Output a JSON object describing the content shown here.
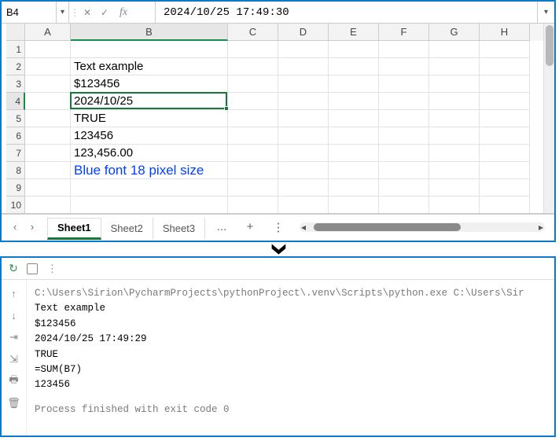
{
  "formula_bar": {
    "name_box": "B4",
    "fx_label": "fx",
    "formula_value": "2024/10/25  17:49:30"
  },
  "columns": [
    "A",
    "B",
    "C",
    "D",
    "E",
    "F",
    "G",
    "H"
  ],
  "rows": [
    "1",
    "2",
    "3",
    "4",
    "5",
    "6",
    "7",
    "8",
    "9",
    "10"
  ],
  "selected_cell": "B4",
  "cells": {
    "B2": "Text example",
    "B3": "$123456",
    "B4": "2024/10/25",
    "B5": "TRUE",
    "B6": "123456",
    "B7": "123,456.00",
    "B8": "Blue font 18 pixel size"
  },
  "sheet_tabs": {
    "tabs": [
      "Sheet1",
      "Sheet2",
      "Sheet3"
    ],
    "active": "Sheet1",
    "more": "...",
    "add": "+"
  },
  "terminal": {
    "path_line": "C:\\Users\\Sirion\\PycharmProjects\\pythonProject\\.venv\\Scripts\\python.exe C:\\Users\\Sir",
    "lines": [
      "Text example",
      "$123456",
      "2024/10/25 17:49:29",
      "TRUE",
      "=SUM(B7)",
      "123456"
    ],
    "exit_line": "Process finished with exit code 0"
  }
}
